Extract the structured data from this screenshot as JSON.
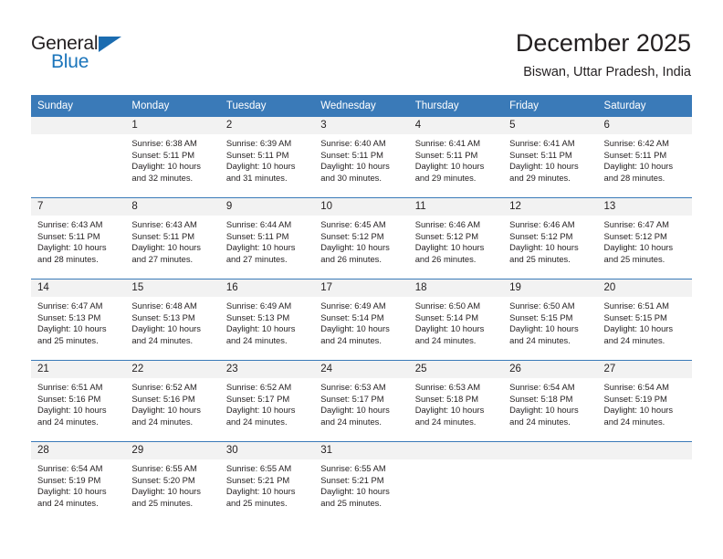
{
  "logo": {
    "word_top": "General",
    "word_bottom": "Blue",
    "triangle_color": "#1b6cb0",
    "blue_color": "#1b75bb"
  },
  "header": {
    "title": "December 2025",
    "subtitle": "Biswan, Uttar Pradesh, India"
  },
  "theme": {
    "header_blue": "#3a7ab8",
    "daynum_band": "#f2f2f2",
    "text": "#231f20"
  },
  "weekday_headers": [
    "Sunday",
    "Monday",
    "Tuesday",
    "Wednesday",
    "Thursday",
    "Friday",
    "Saturday"
  ],
  "weeks": [
    [
      {
        "day": "",
        "sunrise": "",
        "sunset": "",
        "daylight1": "",
        "daylight2": ""
      },
      {
        "day": "1",
        "sunrise": "Sunrise: 6:38 AM",
        "sunset": "Sunset: 5:11 PM",
        "daylight1": "Daylight: 10 hours",
        "daylight2": "and 32 minutes."
      },
      {
        "day": "2",
        "sunrise": "Sunrise: 6:39 AM",
        "sunset": "Sunset: 5:11 PM",
        "daylight1": "Daylight: 10 hours",
        "daylight2": "and 31 minutes."
      },
      {
        "day": "3",
        "sunrise": "Sunrise: 6:40 AM",
        "sunset": "Sunset: 5:11 PM",
        "daylight1": "Daylight: 10 hours",
        "daylight2": "and 30 minutes."
      },
      {
        "day": "4",
        "sunrise": "Sunrise: 6:41 AM",
        "sunset": "Sunset: 5:11 PM",
        "daylight1": "Daylight: 10 hours",
        "daylight2": "and 29 minutes."
      },
      {
        "day": "5",
        "sunrise": "Sunrise: 6:41 AM",
        "sunset": "Sunset: 5:11 PM",
        "daylight1": "Daylight: 10 hours",
        "daylight2": "and 29 minutes."
      },
      {
        "day": "6",
        "sunrise": "Sunrise: 6:42 AM",
        "sunset": "Sunset: 5:11 PM",
        "daylight1": "Daylight: 10 hours",
        "daylight2": "and 28 minutes."
      }
    ],
    [
      {
        "day": "7",
        "sunrise": "Sunrise: 6:43 AM",
        "sunset": "Sunset: 5:11 PM",
        "daylight1": "Daylight: 10 hours",
        "daylight2": "and 28 minutes."
      },
      {
        "day": "8",
        "sunrise": "Sunrise: 6:43 AM",
        "sunset": "Sunset: 5:11 PM",
        "daylight1": "Daylight: 10 hours",
        "daylight2": "and 27 minutes."
      },
      {
        "day": "9",
        "sunrise": "Sunrise: 6:44 AM",
        "sunset": "Sunset: 5:11 PM",
        "daylight1": "Daylight: 10 hours",
        "daylight2": "and 27 minutes."
      },
      {
        "day": "10",
        "sunrise": "Sunrise: 6:45 AM",
        "sunset": "Sunset: 5:12 PM",
        "daylight1": "Daylight: 10 hours",
        "daylight2": "and 26 minutes."
      },
      {
        "day": "11",
        "sunrise": "Sunrise: 6:46 AM",
        "sunset": "Sunset: 5:12 PM",
        "daylight1": "Daylight: 10 hours",
        "daylight2": "and 26 minutes."
      },
      {
        "day": "12",
        "sunrise": "Sunrise: 6:46 AM",
        "sunset": "Sunset: 5:12 PM",
        "daylight1": "Daylight: 10 hours",
        "daylight2": "and 25 minutes."
      },
      {
        "day": "13",
        "sunrise": "Sunrise: 6:47 AM",
        "sunset": "Sunset: 5:12 PM",
        "daylight1": "Daylight: 10 hours",
        "daylight2": "and 25 minutes."
      }
    ],
    [
      {
        "day": "14",
        "sunrise": "Sunrise: 6:47 AM",
        "sunset": "Sunset: 5:13 PM",
        "daylight1": "Daylight: 10 hours",
        "daylight2": "and 25 minutes."
      },
      {
        "day": "15",
        "sunrise": "Sunrise: 6:48 AM",
        "sunset": "Sunset: 5:13 PM",
        "daylight1": "Daylight: 10 hours",
        "daylight2": "and 24 minutes."
      },
      {
        "day": "16",
        "sunrise": "Sunrise: 6:49 AM",
        "sunset": "Sunset: 5:13 PM",
        "daylight1": "Daylight: 10 hours",
        "daylight2": "and 24 minutes."
      },
      {
        "day": "17",
        "sunrise": "Sunrise: 6:49 AM",
        "sunset": "Sunset: 5:14 PM",
        "daylight1": "Daylight: 10 hours",
        "daylight2": "and 24 minutes."
      },
      {
        "day": "18",
        "sunrise": "Sunrise: 6:50 AM",
        "sunset": "Sunset: 5:14 PM",
        "daylight1": "Daylight: 10 hours",
        "daylight2": "and 24 minutes."
      },
      {
        "day": "19",
        "sunrise": "Sunrise: 6:50 AM",
        "sunset": "Sunset: 5:15 PM",
        "daylight1": "Daylight: 10 hours",
        "daylight2": "and 24 minutes."
      },
      {
        "day": "20",
        "sunrise": "Sunrise: 6:51 AM",
        "sunset": "Sunset: 5:15 PM",
        "daylight1": "Daylight: 10 hours",
        "daylight2": "and 24 minutes."
      }
    ],
    [
      {
        "day": "21",
        "sunrise": "Sunrise: 6:51 AM",
        "sunset": "Sunset: 5:16 PM",
        "daylight1": "Daylight: 10 hours",
        "daylight2": "and 24 minutes."
      },
      {
        "day": "22",
        "sunrise": "Sunrise: 6:52 AM",
        "sunset": "Sunset: 5:16 PM",
        "daylight1": "Daylight: 10 hours",
        "daylight2": "and 24 minutes."
      },
      {
        "day": "23",
        "sunrise": "Sunrise: 6:52 AM",
        "sunset": "Sunset: 5:17 PM",
        "daylight1": "Daylight: 10 hours",
        "daylight2": "and 24 minutes."
      },
      {
        "day": "24",
        "sunrise": "Sunrise: 6:53 AM",
        "sunset": "Sunset: 5:17 PM",
        "daylight1": "Daylight: 10 hours",
        "daylight2": "and 24 minutes."
      },
      {
        "day": "25",
        "sunrise": "Sunrise: 6:53 AM",
        "sunset": "Sunset: 5:18 PM",
        "daylight1": "Daylight: 10 hours",
        "daylight2": "and 24 minutes."
      },
      {
        "day": "26",
        "sunrise": "Sunrise: 6:54 AM",
        "sunset": "Sunset: 5:18 PM",
        "daylight1": "Daylight: 10 hours",
        "daylight2": "and 24 minutes."
      },
      {
        "day": "27",
        "sunrise": "Sunrise: 6:54 AM",
        "sunset": "Sunset: 5:19 PM",
        "daylight1": "Daylight: 10 hours",
        "daylight2": "and 24 minutes."
      }
    ],
    [
      {
        "day": "28",
        "sunrise": "Sunrise: 6:54 AM",
        "sunset": "Sunset: 5:19 PM",
        "daylight1": "Daylight: 10 hours",
        "daylight2": "and 24 minutes."
      },
      {
        "day": "29",
        "sunrise": "Sunrise: 6:55 AM",
        "sunset": "Sunset: 5:20 PM",
        "daylight1": "Daylight: 10 hours",
        "daylight2": "and 25 minutes."
      },
      {
        "day": "30",
        "sunrise": "Sunrise: 6:55 AM",
        "sunset": "Sunset: 5:21 PM",
        "daylight1": "Daylight: 10 hours",
        "daylight2": "and 25 minutes."
      },
      {
        "day": "31",
        "sunrise": "Sunrise: 6:55 AM",
        "sunset": "Sunset: 5:21 PM",
        "daylight1": "Daylight: 10 hours",
        "daylight2": "and 25 minutes."
      },
      {
        "day": "",
        "sunrise": "",
        "sunset": "",
        "daylight1": "",
        "daylight2": ""
      },
      {
        "day": "",
        "sunrise": "",
        "sunset": "",
        "daylight1": "",
        "daylight2": ""
      },
      {
        "day": "",
        "sunrise": "",
        "sunset": "",
        "daylight1": "",
        "daylight2": ""
      }
    ]
  ]
}
